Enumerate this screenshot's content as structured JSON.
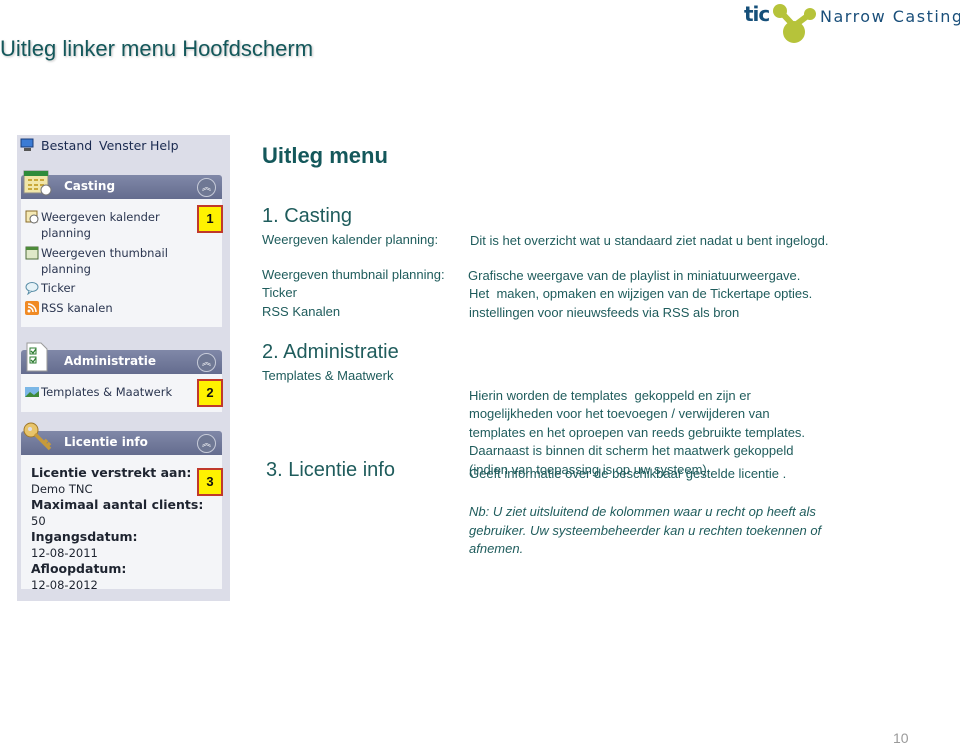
{
  "page": {
    "title": "Uitleg linker menu Hoofdscherm",
    "page_number": "10"
  },
  "logo": {
    "mark": "tic",
    "brand": "Narrow Casting",
    "colors": {
      "mark": "#16507a",
      "blob": "#b6c33a"
    }
  },
  "screenshot": {
    "menubar": [
      "Bestand",
      "Venster",
      "Help"
    ],
    "groups": [
      {
        "title": "Casting",
        "icon": "calendar-icon",
        "badge": "1",
        "items": [
          {
            "label_lines": [
              "Weergeven kalender",
              "planning"
            ],
            "icon": "calendar-clock-icon"
          },
          {
            "label_lines": [
              "Weergeven thumbnail",
              "planning"
            ],
            "icon": "thumbnail-icon"
          },
          {
            "label_lines": [
              "Ticker"
            ],
            "icon": "speech-bubble-icon"
          },
          {
            "label_lines": [
              "RSS kanalen"
            ],
            "icon": "rss-icon"
          }
        ]
      },
      {
        "title": "Administratie",
        "icon": "checklist-icon",
        "badge": "2",
        "items": [
          {
            "label_lines": [
              "Templates & Maatwerk"
            ],
            "icon": "landscape-image-icon"
          }
        ]
      },
      {
        "title": "Licentie info",
        "icon": "key-icon",
        "badge": "3",
        "license": [
          {
            "label": "Licentie verstrekt aan:",
            "value": "Demo TNC"
          },
          {
            "label": "Maximaal aantal clients:",
            "value": "50"
          },
          {
            "label": "Ingangsdatum:",
            "value": "12-08-2011"
          },
          {
            "label": "Afloopdatum:",
            "value": "12-08-2012"
          }
        ]
      }
    ],
    "badge_colors": {
      "fill": "#fff200",
      "border": "#c0392b"
    }
  },
  "content": {
    "heading": "Uitleg menu",
    "sections": [
      {
        "title": "1. Casting",
        "rows": [
          {
            "label": "Weergeven kalender planning:",
            "desc": "Dit is het overzicht wat u standaard ziet nadat u bent ingelogd."
          },
          {
            "label": "Weergeven thumbnail planning:",
            "desc": "Grafische weergave van de playlist in miniatuurweergave."
          },
          {
            "label": "Ticker",
            "desc": "Het  maken, opmaken en wijzigen van de Tickertape opties."
          },
          {
            "label": "RSS Kanalen",
            "desc": "instellingen voor nieuwsfeeds via RSS als bron"
          }
        ]
      },
      {
        "title": "2. Administratie",
        "rows": [
          {
            "label": "Templates & Maatwerk",
            "desc_lines": [
              "Hierin worden de templates  gekoppeld en zijn er",
              "mogelijkheden voor het toevoegen / verwijderen van",
              "templates en het oproepen van reeds gebruikte templates.",
              "Daarnaast is binnen dit scherm het maatwerk gekoppeld",
              "(indien van toepassing is op uw systeem)."
            ]
          }
        ]
      },
      {
        "title": "3. Licentie info",
        "desc": "Geeft informatie over de beschikbaar gestelde licentie .",
        "note_lines": [
          "Nb: U ziet uitsluitend de kolommen waar u recht op heeft als",
          "gebruiker. Uw systeembeheerder kan u rechten toekennen of",
          "afnemen."
        ]
      }
    ],
    "text_color": "#1f5c5c"
  }
}
